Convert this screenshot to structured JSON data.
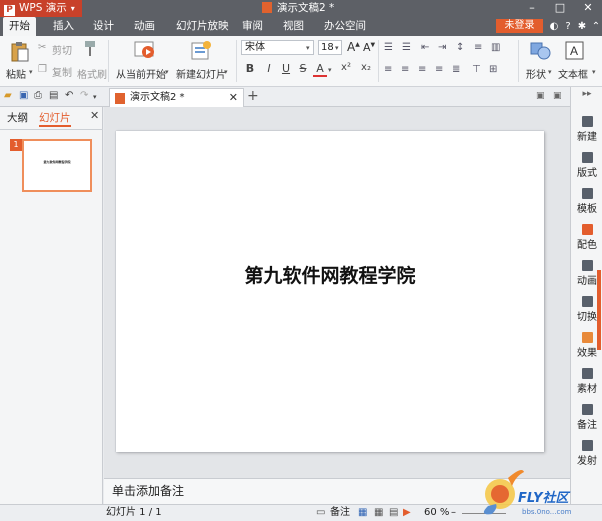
{
  "app": {
    "name": "WPS 演示",
    "menu_arrow": "▾",
    "doc_title": "演示文稿2 *"
  },
  "window_controls": [
    "–",
    "□",
    "✕"
  ],
  "tabs": [
    "开始",
    "插入",
    "设计",
    "动画",
    "幻灯片放映",
    "审阅",
    "视图",
    "办公空间"
  ],
  "login_label": "未登录",
  "ribbon": {
    "clipboard": {
      "paste": "粘贴",
      "cut": "剪切",
      "copy": "复制",
      "format_painter": "格式刷"
    },
    "from_current": "从当前开始",
    "new_slide": "新建幻灯片",
    "font_name": "宋体",
    "font_size": "18",
    "format_buttons": [
      "B",
      "I",
      "U",
      "S",
      "A",
      "x²",
      "x₂"
    ],
    "shape": "形状",
    "textbox": "文本框"
  },
  "doc_tab": {
    "title": "演示文稿2 *"
  },
  "left_panel": {
    "tabs": [
      "大纲",
      "幻灯片"
    ],
    "slide_number": "1",
    "thumb_text": "第九软件网教程学院"
  },
  "slide": {
    "title_text": "第九软件网教程学院"
  },
  "notes_placeholder": "单击添加备注",
  "right_sidebar": [
    "新建",
    "版式",
    "模板",
    "配色",
    "动画",
    "切换",
    "效果",
    "素材",
    "备注",
    "发射"
  ],
  "status": {
    "slide_info": "幻灯片 1 / 1",
    "notes": "备注",
    "zoom": "60 %"
  },
  "watermark": {
    "brand": "FLY社区",
    "url": "bbs.0no...com"
  },
  "colors": {
    "accent": "#e35d2d",
    "titlebar": "#5d6066",
    "app_button": "#c8412a"
  }
}
